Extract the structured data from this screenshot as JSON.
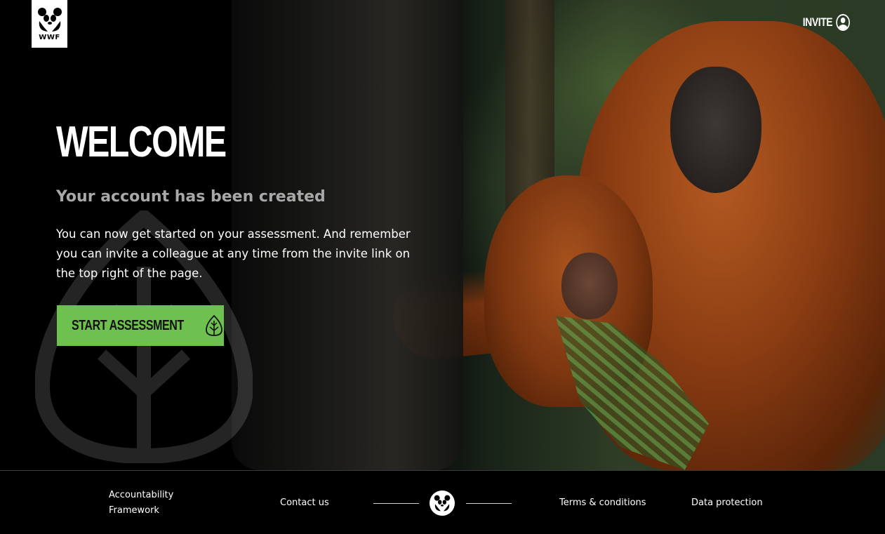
{
  "header": {
    "logo_text": "WWF",
    "invite_label": "INVITE"
  },
  "hero": {
    "title": "WELCOME",
    "subtitle": "Your account has been created",
    "body": "You can now get started on your assessment.  And remember you can invite a colleague at any time from the invite link on the top right of the page.",
    "cta_label": "START ASSESSMENT"
  },
  "footer": {
    "accountability_line1": "Accountability",
    "accountability_line2": "Framework",
    "contact": "Contact us",
    "terms": "Terms & conditions",
    "data_protection": "Data protection"
  },
  "colors": {
    "accent_green": "#6ec04f",
    "subtitle_grey": "#a8a8a8",
    "background": "#000000"
  },
  "icons": [
    "panda-logo-icon",
    "user-icon",
    "leaf-icon",
    "leaf-watermark-icon",
    "panda-footer-icon"
  ]
}
